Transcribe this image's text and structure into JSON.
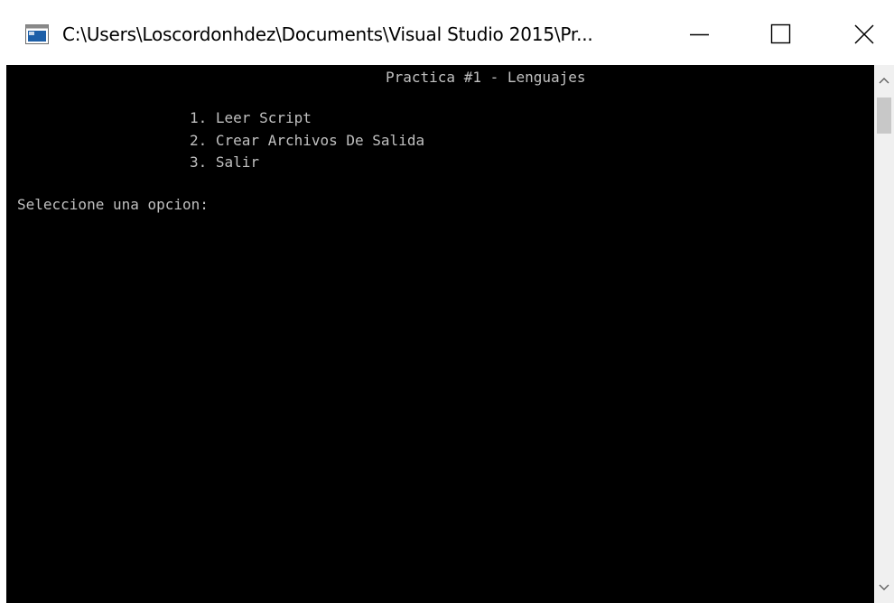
{
  "window": {
    "title": "C:\\Users\\Loscordonhdez\\Documents\\Visual Studio 2015\\Pr...",
    "icon": "console-app-icon",
    "controls": {
      "minimize": "minimize-icon",
      "maximize": "maximize-icon",
      "close": "close-icon"
    }
  },
  "console": {
    "header": "Practica #1 - Lenguajes",
    "menu": [
      "1. Leer Script",
      "2. Crear Archivos De Salida",
      "3. Salir"
    ],
    "prompt": "Seleccione una opcion:"
  },
  "colors": {
    "console_background": "#000000",
    "console_text": "#c0c0c0",
    "titlebar_background": "#ffffff",
    "scrollbar_track": "#f0f0f0",
    "scrollbar_thumb": "#c8c8c8"
  }
}
